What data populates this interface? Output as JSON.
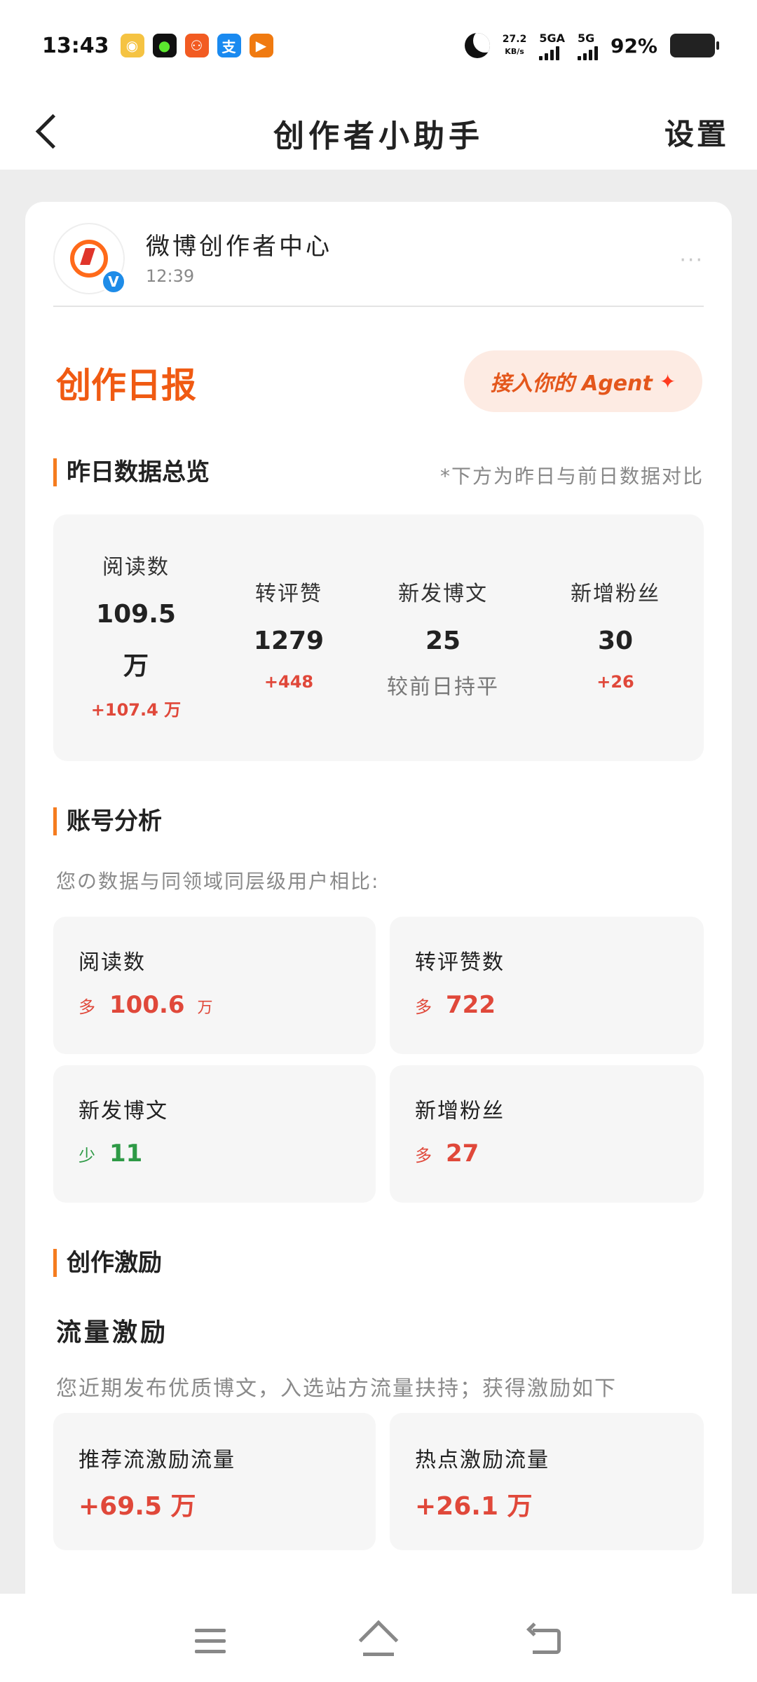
{
  "status_bar": {
    "time": "13:43",
    "net_speed_value": "27.2",
    "net_speed_unit": "KB/s",
    "signal1_label": "5GA",
    "signal2_label": "5G",
    "battery": "92%",
    "app_icons": [
      {
        "name": "weibo-app-icon",
        "color": "#f5c342",
        "glyph": "◉"
      },
      {
        "name": "green-app-icon",
        "color": "#111111",
        "glyph": "●"
      },
      {
        "name": "orange-app-icon",
        "color": "#f25b22",
        "glyph": "⚇"
      },
      {
        "name": "alipay-app-icon",
        "color": "#1a8af0",
        "glyph": "支"
      },
      {
        "name": "tv-app-icon",
        "color": "#f07a10",
        "glyph": "▶"
      }
    ]
  },
  "nav": {
    "title": "创作者小助手",
    "settings": "设置"
  },
  "account": {
    "name": "微博创作者中心",
    "time": "12:39",
    "more": "···",
    "verified_badge": "V"
  },
  "report": {
    "title": "创作日报",
    "agent_button": "接入你的 Agent",
    "spark": "✦"
  },
  "overview": {
    "title": "昨日数据总览",
    "note": "*下方为昨日与前日数据对比",
    "items": [
      {
        "label": "阅读数",
        "value_line1": "109.5",
        "value_line2": "万",
        "delta": "+107.4 万"
      },
      {
        "label": "转评赞",
        "value": "1279",
        "delta": "+448"
      },
      {
        "label": "新发博文",
        "value": "25",
        "delta": "较前日持平"
      },
      {
        "label": "新增粉丝",
        "value": "30",
        "delta": "+26"
      }
    ]
  },
  "analysis": {
    "title": "账号分析",
    "intro": "您の数据与同领域同层级用户相比:",
    "tiles": [
      {
        "label": "阅读数",
        "prefix": "多",
        "value": "100.6",
        "unit": "万"
      },
      {
        "label": "转评赞数",
        "prefix": "多",
        "value": "722",
        "unit": ""
      },
      {
        "label": "新发博文",
        "prefix": "少",
        "value": "11",
        "unit": ""
      },
      {
        "label": "新增粉丝",
        "prefix": "多",
        "value": "27",
        "unit": ""
      }
    ]
  },
  "incentive": {
    "title": "创作激励",
    "flow_title": "流量激励",
    "flow_intro": "您近期发布优质博文，入选站方流量扶持；获得激励如下",
    "rewards": [
      {
        "label": "推荐流激励流量",
        "value": "+69.5 万"
      },
      {
        "label": "热点激励流量",
        "value": "+26.1 万"
      }
    ]
  },
  "colors": {
    "accent_orange": "#f05a12",
    "increase_red": "#e0483a",
    "decrease_green": "#2e9a46",
    "verified_blue": "#1e8ce8"
  }
}
